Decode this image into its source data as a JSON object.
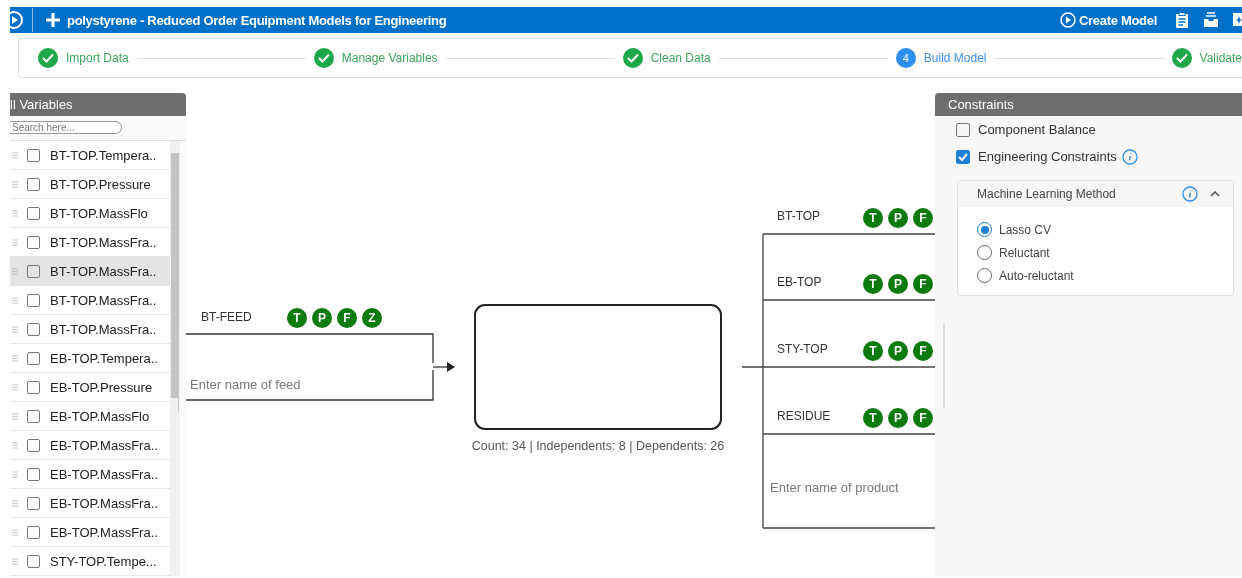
{
  "app_bar": {
    "title": "polystyrene - Reduced Order Equipment Models for Engineering",
    "create_button": "Create Model"
  },
  "steps": [
    {
      "label": "Import Data",
      "kind": "done"
    },
    {
      "label": "Manage Variables",
      "kind": "done"
    },
    {
      "label": "Clean Data",
      "kind": "done"
    },
    {
      "label": "Build Model",
      "kind": "current",
      "number": "4"
    },
    {
      "label": "Validate",
      "kind": "done"
    }
  ],
  "variables_panel": {
    "title": "ll Variables",
    "search": {
      "placeholder": "Search here..."
    },
    "items": [
      {
        "label": "BT-TOP.Tempera..",
        "checked": false,
        "highlighted": false
      },
      {
        "label": "BT-TOP.Pressure",
        "checked": false,
        "highlighted": false
      },
      {
        "label": "BT-TOP.MassFlo",
        "checked": false,
        "highlighted": false
      },
      {
        "label": "BT-TOP.MassFra..",
        "checked": false,
        "highlighted": false
      },
      {
        "label": "BT-TOP.MassFra..",
        "checked": false,
        "highlighted": true
      },
      {
        "label": "BT-TOP.MassFra..",
        "checked": false,
        "highlighted": false
      },
      {
        "label": "BT-TOP.MassFra..",
        "checked": false,
        "highlighted": false
      },
      {
        "label": "EB-TOP.Tempera..",
        "checked": false,
        "highlighted": false
      },
      {
        "label": "EB-TOP.Pressure",
        "checked": false,
        "highlighted": false
      },
      {
        "label": "EB-TOP.MassFlo",
        "checked": false,
        "highlighted": false
      },
      {
        "label": "EB-TOP.MassFra..",
        "checked": false,
        "highlighted": false
      },
      {
        "label": "EB-TOP.MassFra..",
        "checked": false,
        "highlighted": false
      },
      {
        "label": "EB-TOP.MassFra..",
        "checked": false,
        "highlighted": false
      },
      {
        "label": "EB-TOP.MassFra..",
        "checked": false,
        "highlighted": false
      },
      {
        "label": "STY-TOP.Tempe...",
        "checked": false,
        "highlighted": false
      }
    ]
  },
  "model": {
    "feed": {
      "name": "BT-FEED",
      "badges": [
        "T",
        "P",
        "F",
        "Z"
      ],
      "placeholder": "Enter name of feed"
    },
    "summary": "Count: 34 | Independents: 8 | Dependents: 26",
    "products": [
      {
        "name": "BT-TOP",
        "badges": [
          "T",
          "P",
          "F"
        ]
      },
      {
        "name": "EB-TOP",
        "badges": [
          "T",
          "P",
          "F"
        ]
      },
      {
        "name": "STY-TOP",
        "badges": [
          "T",
          "P",
          "F"
        ]
      },
      {
        "name": "RESIDUE",
        "badges": [
          "T",
          "P",
          "F"
        ]
      }
    ],
    "product_placeholder": "Enter name of product"
  },
  "constraints": {
    "title": "Constraints",
    "options": [
      {
        "label": "Component Balance",
        "checked": false,
        "info": false
      },
      {
        "label": "Engineering Constraints",
        "checked": true,
        "info": true
      }
    ],
    "ml_method": {
      "title": "Machine Learning Method",
      "expanded": true,
      "choices": [
        {
          "label": "Lasso CV",
          "selected": true
        },
        {
          "label": "Reluctant",
          "selected": false
        },
        {
          "label": "Auto-reluctant",
          "selected": false
        }
      ]
    }
  }
}
